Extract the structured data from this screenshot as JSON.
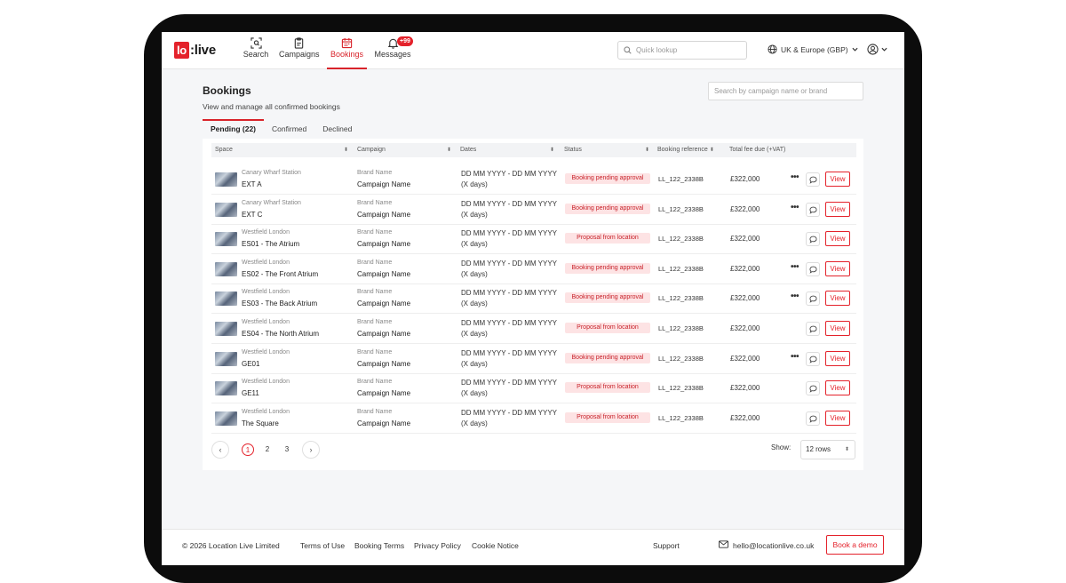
{
  "brand": {
    "logo_box": "lo",
    "logo_text": ":live"
  },
  "nav": {
    "items": [
      {
        "label": "Search",
        "icon": "scan-search-icon"
      },
      {
        "label": "Campaigns",
        "icon": "clipboard-icon"
      },
      {
        "label": "Bookings",
        "icon": "calendar-icon",
        "active": true
      },
      {
        "label": "Messages",
        "icon": "bell-icon",
        "badge": "+99"
      }
    ]
  },
  "header": {
    "quick_lookup_placeholder": "Quick lookup",
    "region": "UK & Europe (GBP)"
  },
  "page": {
    "title": "Bookings",
    "subtitle": "View and manage all confirmed bookings",
    "search_placeholder": "Search by campaign name or brand"
  },
  "tabs": [
    {
      "label": "Pending (22)",
      "active": true
    },
    {
      "label": "Confirmed"
    },
    {
      "label": "Declined"
    }
  ],
  "table": {
    "columns": [
      "Space",
      "Campaign",
      "Dates",
      "Status",
      "Booking reference",
      "Total fee due (+VAT)"
    ],
    "rows": [
      {
        "location": "Canary Wharf Station",
        "space": "EXT A",
        "brand": "Brand Name",
        "campaign": "Campaign Name",
        "dates": "DD MM YYYY - DD MM YYYY",
        "days": "(X days)",
        "status": "Booking pending approval",
        "ref": "LL_122_2338B",
        "fee": "£322,000",
        "more": "•••",
        "view": "View"
      },
      {
        "location": "Canary Wharf Station",
        "space": "EXT C",
        "brand": "Brand Name",
        "campaign": "Campaign Name",
        "dates": "DD MM YYYY - DD MM YYYY",
        "days": "(X days)",
        "status": "Booking pending approval",
        "ref": "LL_122_2338B",
        "fee": "£322,000",
        "more": "•••",
        "view": "View"
      },
      {
        "location": "Westfield London",
        "space": "ES01 - The Atrium",
        "brand": "Brand Name",
        "campaign": "Campaign Name",
        "dates": "DD MM YYYY - DD MM YYYY",
        "days": "(X days)",
        "status": "Proposal from location",
        "ref": "LL_122_2338B",
        "fee": "£322,000",
        "more": "",
        "view": "View"
      },
      {
        "location": "Westfield London",
        "space": "ES02 - The Front Atrium",
        "brand": "Brand Name",
        "campaign": "Campaign Name",
        "dates": "DD MM YYYY - DD MM YYYY",
        "days": "(X days)",
        "status": "Booking pending approval",
        "ref": "LL_122_2338B",
        "fee": "£322,000",
        "more": "•••",
        "view": "View"
      },
      {
        "location": "Westfield London",
        "space": "ES03 - The Back Atrium",
        "brand": "Brand Name",
        "campaign": "Campaign Name",
        "dates": "DD MM YYYY - DD MM YYYY",
        "days": "(X days)",
        "status": "Booking pending approval",
        "ref": "LL_122_2338B",
        "fee": "£322,000",
        "more": "•••",
        "view": "View"
      },
      {
        "location": "Westfield London",
        "space": "ES04 - The North Atrium",
        "brand": "Brand Name",
        "campaign": "Campaign Name",
        "dates": "DD MM YYYY - DD MM YYYY",
        "days": "(X days)",
        "status": "Proposal from location",
        "ref": "LL_122_2338B",
        "fee": "£322,000",
        "more": "",
        "view": "View"
      },
      {
        "location": "Westfield London",
        "space": "GE01",
        "brand": "Brand Name",
        "campaign": "Campaign Name",
        "dates": "DD MM YYYY - DD MM YYYY",
        "days": "(X days)",
        "status": "Booking pending approval",
        "ref": "LL_122_2338B",
        "fee": "£322,000",
        "more": "•••",
        "view": "View"
      },
      {
        "location": "Westfield London",
        "space": "GE11",
        "brand": "Brand Name",
        "campaign": "Campaign Name",
        "dates": "DD MM YYYY - DD MM YYYY",
        "days": "(X days)",
        "status": "Proposal from location",
        "ref": "LL_122_2338B",
        "fee": "£322,000",
        "more": "",
        "view": "View"
      },
      {
        "location": "Westfield London",
        "space": "The Square",
        "brand": "Brand Name",
        "campaign": "Campaign Name",
        "dates": "DD MM YYYY - DD MM YYYY",
        "days": "(X days)",
        "status": "Proposal from location",
        "ref": "LL_122_2338B",
        "fee": "£322,000",
        "more": "",
        "view": "View"
      }
    ]
  },
  "pagination": {
    "pages": [
      "1",
      "2",
      "3"
    ],
    "current": "1",
    "show_label": "Show:",
    "rows_value": "12 rows"
  },
  "footer": {
    "copyright": "© 2026 Location Live Limited",
    "links": [
      "Terms of Use",
      "Booking Terms",
      "Privacy Policy",
      "Cookie Notice"
    ],
    "support": "Support",
    "email": "hello@locationlive.co.uk",
    "cta": "Book a demo"
  },
  "colors": {
    "accent": "#e4222b",
    "status_bg": "#fde3e4",
    "page_bg": "#f5f6f8"
  }
}
